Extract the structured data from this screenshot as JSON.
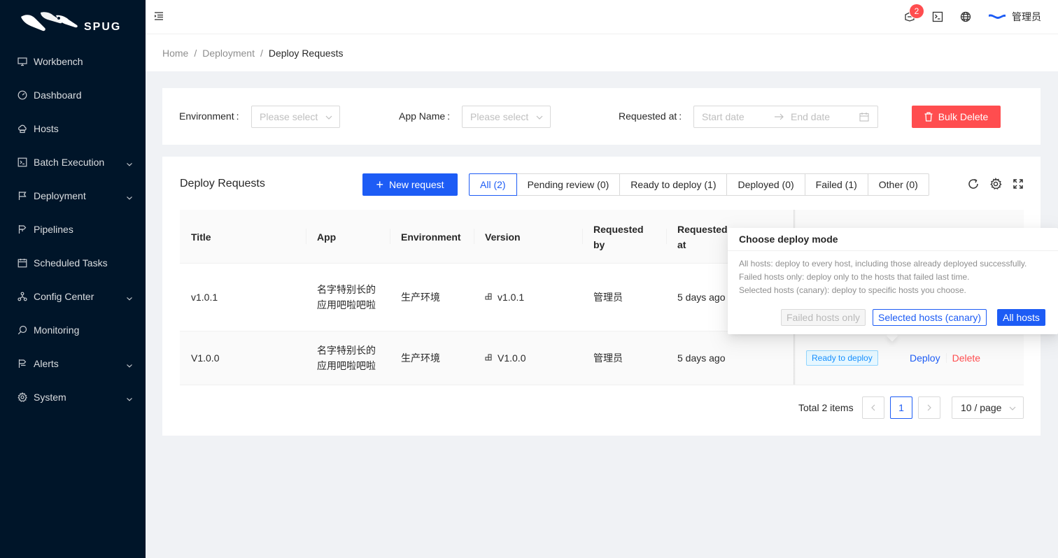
{
  "brand": {
    "logo_text": "SPUG"
  },
  "sidebar": {
    "items": [
      {
        "label": "Workbench",
        "icon": "desktop-icon",
        "submenu": false
      },
      {
        "label": "Dashboard",
        "icon": "dashboard-icon",
        "submenu": false
      },
      {
        "label": "Hosts",
        "icon": "cloud-server-icon",
        "submenu": false
      },
      {
        "label": "Batch Execution",
        "icon": "code-icon",
        "submenu": true
      },
      {
        "label": "Deployment",
        "icon": "flag-icon",
        "submenu": true
      },
      {
        "label": "Pipelines",
        "icon": "pipeline-icon",
        "submenu": false
      },
      {
        "label": "Scheduled Tasks",
        "icon": "schedule-icon",
        "submenu": false
      },
      {
        "label": "Config Center",
        "icon": "deployment-unit-icon",
        "submenu": true
      },
      {
        "label": "Monitoring",
        "icon": "monitor-icon",
        "submenu": false
      },
      {
        "label": "Alerts",
        "icon": "alert-icon",
        "submenu": true
      },
      {
        "label": "System",
        "icon": "setting-icon",
        "submenu": true
      }
    ]
  },
  "header": {
    "notification_count": "2",
    "user_name": "管理员"
  },
  "breadcrumb": {
    "home": "Home",
    "section": "Deployment",
    "current": "Deploy Requests"
  },
  "filters": {
    "environment_label": "Environment",
    "environment_placeholder": "Please select",
    "app_label": "App Name",
    "app_placeholder": "Please select",
    "requested_label": "Requested at",
    "start_placeholder": "Start date",
    "end_placeholder": "End date",
    "bulk_delete": "Bulk Delete",
    "colon": ":"
  },
  "main": {
    "title": "Deploy Requests",
    "new_request": "New request",
    "tabs": [
      {
        "label": "All (2)",
        "active": true
      },
      {
        "label": "Pending review (0)",
        "active": false
      },
      {
        "label": "Ready to deploy (1)",
        "active": false
      },
      {
        "label": "Deployed (0)",
        "active": false
      },
      {
        "label": "Failed (1)",
        "active": false
      },
      {
        "label": "Other (0)",
        "active": false
      }
    ]
  },
  "table": {
    "columns": {
      "title": "Title",
      "app": "App",
      "environment": "Environment",
      "version": "Version",
      "requested_by_1": "Requested",
      "requested_by_2": "by",
      "requested_at_1": "Requested",
      "requested_at_2": "at"
    },
    "rows": [
      {
        "title": "v1.0.1",
        "app_1": "名字特别长的",
        "app_2": "应用吧啦吧啦",
        "environment": "生产环境",
        "version": "v1.0.1",
        "requested_by": "管理员",
        "requested_at": "5 days ago"
      },
      {
        "title": "V1.0.0",
        "app_1": "名字特别长的",
        "app_2": "应用吧啦吧啦",
        "environment": "生产环境",
        "version": "V1.0.0",
        "requested_by": "管理员",
        "requested_at": "5 days ago",
        "status": "Ready to deploy",
        "action_deploy": "Deploy",
        "action_delete": "Delete"
      }
    ]
  },
  "pagination": {
    "total": "Total 2 items",
    "page": "1",
    "page_size": "10 / page"
  },
  "popconfirm": {
    "title": "Choose deploy mode",
    "desc_1": "All hosts: deploy to every host, including those already deployed successfully.",
    "desc_2": "Failed hosts only: deploy only to the hosts that failed last time.",
    "desc_3": "Selected hosts (canary): deploy to specific hosts you choose.",
    "btn_failed": "Failed hosts only",
    "btn_selected": "Selected hosts (canary)",
    "btn_all": "All hosts"
  },
  "colors": {
    "sidebar_bg": "#001529",
    "primary": "#1d5cf5",
    "danger": "#ff4d4f"
  }
}
